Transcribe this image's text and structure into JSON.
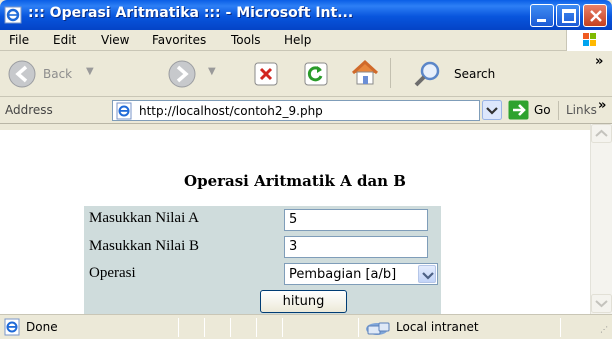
{
  "window": {
    "title": "::: Operasi Aritmatika ::: - Microsoft Int...",
    "colors": {
      "titlebar": "#0855dd",
      "chrome": "#ece9d8",
      "form_panel": "#cfdcdc",
      "close": "#c5401f"
    }
  },
  "menu": [
    "File",
    "Edit",
    "View",
    "Favorites",
    "Tools",
    "Help"
  ],
  "toolbar": {
    "back_label": "Back",
    "search_label": "Search",
    "more": "»"
  },
  "address": {
    "label": "Address",
    "url": "http://localhost/contoh2_9.php",
    "go_label": "Go",
    "links_label": "Links",
    "more": "»"
  },
  "page": {
    "heading": "Operasi Aritmatik A dan B",
    "form": {
      "label_a": "Masukkan Nilai A",
      "value_a": "5",
      "label_b": "Masukkan Nilai B",
      "value_b": "3",
      "label_op": "Operasi",
      "op_selected": "Pembagian [a/b]",
      "submit_label": "hitung"
    }
  },
  "status": {
    "text": "Done",
    "zone": "Local intranet"
  },
  "icons": [
    "ie-icon",
    "minimize-icon",
    "maximize-icon",
    "close-icon",
    "windows-flag-icon",
    "back-icon",
    "forward-icon",
    "stop-icon",
    "refresh-icon",
    "home-icon",
    "search-icon",
    "page-icon",
    "dropdown-icon",
    "go-arrow-icon",
    "intranet-icon"
  ]
}
